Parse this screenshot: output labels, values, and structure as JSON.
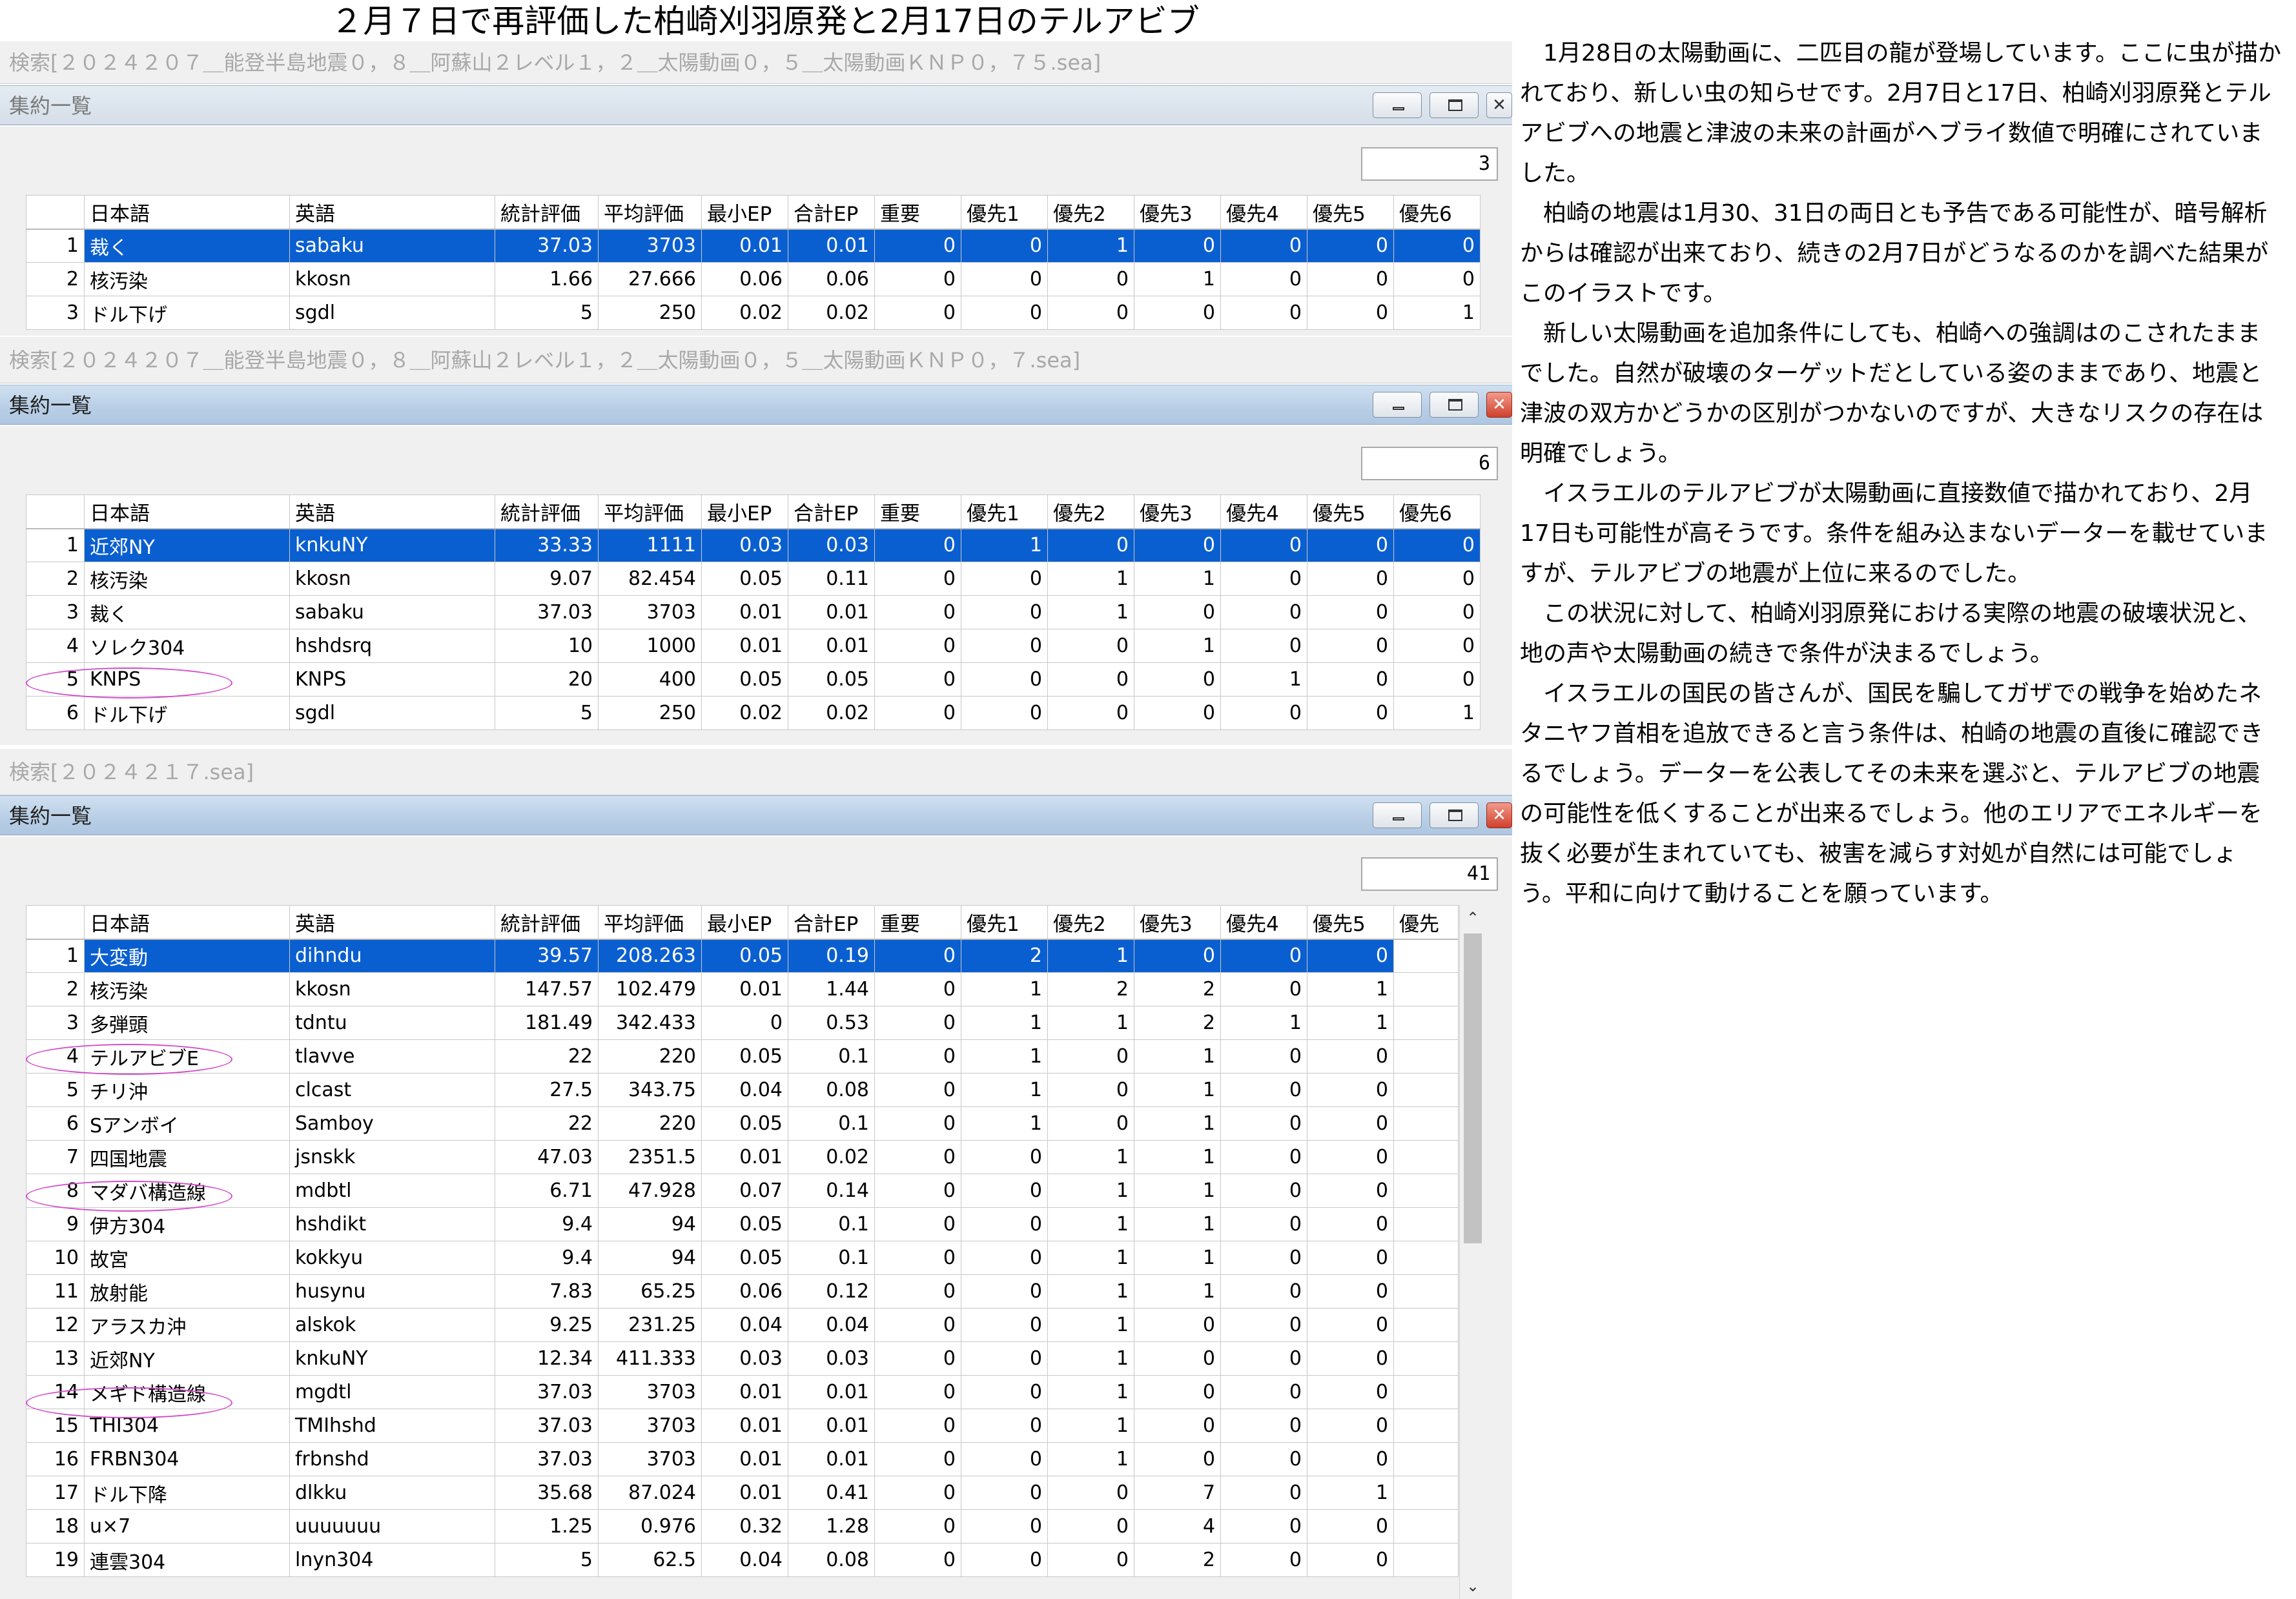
{
  "page": {
    "title": "２月７日で再評価した柏崎刈羽原発と2月17日のテルアビブ"
  },
  "panels": [
    {
      "search_title": "検索[２０２４２０７＿能登半島地震０，８＿阿蘇山２レベル１，２＿太陽動画０，５＿太陽動画ＫＮＰ０，７５.sea]",
      "window_title": "集約一覧",
      "active": false,
      "count": "3",
      "columns": [
        "",
        "日本語",
        "英語",
        "統計評価",
        "平均評価",
        "最小EP",
        "合計EP",
        "重要",
        "優先1",
        "優先2",
        "優先3",
        "優先4",
        "優先5",
        "優先6"
      ],
      "rows": [
        [
          "1",
          "裁く",
          "sabaku",
          "37.03",
          "3703",
          "0.01",
          "0.01",
          "0",
          "0",
          "1",
          "0",
          "0",
          "0",
          "0"
        ],
        [
          "2",
          "核汚染",
          "kkosn",
          "1.66",
          "27.666",
          "0.06",
          "0.06",
          "0",
          "0",
          "0",
          "1",
          "0",
          "0",
          "0"
        ],
        [
          "3",
          "ドル下げ",
          "sgdl",
          "5",
          "250",
          "0.02",
          "0.02",
          "0",
          "0",
          "0",
          "0",
          "0",
          "0",
          "1"
        ]
      ]
    },
    {
      "search_title": "検索[２０２４２０７＿能登半島地震０，８＿阿蘇山２レベル１，２＿太陽動画０，５＿太陽動画ＫＮＰ０，７.sea]",
      "window_title": "集約一覧",
      "active": true,
      "count": "6",
      "columns": [
        "",
        "日本語",
        "英語",
        "統計評価",
        "平均評価",
        "最小EP",
        "合計EP",
        "重要",
        "優先1",
        "優先2",
        "優先3",
        "優先4",
        "優先5",
        "優先6"
      ],
      "rows": [
        [
          "1",
          "近郊NY",
          "knkuNY",
          "33.33",
          "1111",
          "0.03",
          "0.03",
          "0",
          "1",
          "0",
          "0",
          "0",
          "0",
          "0"
        ],
        [
          "2",
          "核汚染",
          "kkosn",
          "9.07",
          "82.454",
          "0.05",
          "0.11",
          "0",
          "0",
          "1",
          "1",
          "0",
          "0",
          "0"
        ],
        [
          "3",
          "裁く",
          "sabaku",
          "37.03",
          "3703",
          "0.01",
          "0.01",
          "0",
          "0",
          "1",
          "0",
          "0",
          "0",
          "0"
        ],
        [
          "4",
          "ソレク304",
          "hshdsrq",
          "10",
          "1000",
          "0.01",
          "0.01",
          "0",
          "0",
          "0",
          "1",
          "0",
          "0",
          "0"
        ],
        [
          "5",
          "KNPS",
          "KNPS",
          "20",
          "400",
          "0.05",
          "0.05",
          "0",
          "0",
          "0",
          "0",
          "1",
          "0",
          "0"
        ],
        [
          "6",
          "ドル下げ",
          "sgdl",
          "5",
          "250",
          "0.02",
          "0.02",
          "0",
          "0",
          "0",
          "0",
          "0",
          "0",
          "1"
        ]
      ]
    },
    {
      "search_title": "検索[２０２４２１７.sea]",
      "window_title": "集約一覧",
      "active": true,
      "count": "41",
      "columns": [
        "",
        "日本語",
        "英語",
        "統計評価",
        "平均評価",
        "最小EP",
        "合計EP",
        "重要",
        "優先1",
        "優先2",
        "優先3",
        "優先4",
        "優先5",
        "優先"
      ],
      "rows": [
        [
          "1",
          "大変動",
          "dihndu",
          "39.57",
          "208.263",
          "0.05",
          "0.19",
          "0",
          "2",
          "1",
          "0",
          "0",
          "0",
          ""
        ],
        [
          "2",
          "核汚染",
          "kkosn",
          "147.57",
          "102.479",
          "0.01",
          "1.44",
          "0",
          "1",
          "2",
          "2",
          "0",
          "1",
          ""
        ],
        [
          "3",
          "多弾頭",
          "tdntu",
          "181.49",
          "342.433",
          "0",
          "0.53",
          "0",
          "1",
          "1",
          "2",
          "1",
          "1",
          ""
        ],
        [
          "4",
          "テルアビブE",
          "tlavve",
          "22",
          "220",
          "0.05",
          "0.1",
          "0",
          "1",
          "0",
          "1",
          "0",
          "0",
          ""
        ],
        [
          "5",
          "チリ沖",
          "clcast",
          "27.5",
          "343.75",
          "0.04",
          "0.08",
          "0",
          "1",
          "0",
          "1",
          "0",
          "0",
          ""
        ],
        [
          "6",
          "Sアンボイ",
          "Samboy",
          "22",
          "220",
          "0.05",
          "0.1",
          "0",
          "1",
          "0",
          "1",
          "0",
          "0",
          ""
        ],
        [
          "7",
          "四国地震",
          "jsnskk",
          "47.03",
          "2351.5",
          "0.01",
          "0.02",
          "0",
          "0",
          "1",
          "1",
          "0",
          "0",
          ""
        ],
        [
          "8",
          "マダバ構造線",
          "mdbtl",
          "6.71",
          "47.928",
          "0.07",
          "0.14",
          "0",
          "0",
          "1",
          "1",
          "0",
          "0",
          ""
        ],
        [
          "9",
          "伊方304",
          "hshdikt",
          "9.4",
          "94",
          "0.05",
          "0.1",
          "0",
          "0",
          "1",
          "1",
          "0",
          "0",
          ""
        ],
        [
          "10",
          "故宮",
          "kokkyu",
          "9.4",
          "94",
          "0.05",
          "0.1",
          "0",
          "0",
          "1",
          "1",
          "0",
          "0",
          ""
        ],
        [
          "11",
          "放射能",
          "husynu",
          "7.83",
          "65.25",
          "0.06",
          "0.12",
          "0",
          "0",
          "1",
          "1",
          "0",
          "0",
          ""
        ],
        [
          "12",
          "アラスカ沖",
          "alskok",
          "9.25",
          "231.25",
          "0.04",
          "0.04",
          "0",
          "0",
          "1",
          "0",
          "0",
          "0",
          ""
        ],
        [
          "13",
          "近郊NY",
          "knkuNY",
          "12.34",
          "411.333",
          "0.03",
          "0.03",
          "0",
          "0",
          "1",
          "0",
          "0",
          "0",
          ""
        ],
        [
          "14",
          "メギド構造線",
          "mgdtl",
          "37.03",
          "3703",
          "0.01",
          "0.01",
          "0",
          "0",
          "1",
          "0",
          "0",
          "0",
          ""
        ],
        [
          "15",
          "THI304",
          "TMIhshd",
          "37.03",
          "3703",
          "0.01",
          "0.01",
          "0",
          "0",
          "1",
          "0",
          "0",
          "0",
          ""
        ],
        [
          "16",
          "FRBN304",
          "frbnshd",
          "37.03",
          "3703",
          "0.01",
          "0.01",
          "0",
          "0",
          "1",
          "0",
          "0",
          "0",
          ""
        ],
        [
          "17",
          "ドル下降",
          "dlkku",
          "35.68",
          "87.024",
          "0.01",
          "0.41",
          "0",
          "0",
          "0",
          "7",
          "0",
          "1",
          ""
        ],
        [
          "18",
          "u×7",
          "uuuuuuu",
          "1.25",
          "0.976",
          "0.32",
          "1.28",
          "0",
          "0",
          "0",
          "4",
          "0",
          "0",
          ""
        ],
        [
          "19",
          "連雲304",
          "lnyn304",
          "5",
          "62.5",
          "0.04",
          "0.08",
          "0",
          "0",
          "0",
          "2",
          "0",
          "0",
          ""
        ]
      ]
    }
  ],
  "article": {
    "paragraphs": [
      "　1月28日の太陽動画に、二匹目の龍が登場しています。ここに虫が描かれており、新しい虫の知らせです。2月7日と17日、柏崎刈羽原発とテルアビブへの地震と津波の未来の計画がヘブライ数値で明確にされていました。",
      "　柏崎の地震は1月30、31日の両日とも予告である可能性が、暗号解析からは確認が出来ており、続きの2月7日がどうなるのかを調べた結果がこのイラストです。",
      "　新しい太陽動画を追加条件にしても、柏崎への強調はのこされたままでした。自然が破壊のターゲットだとしている姿のままであり、地震と津波の双方かどうかの区別がつかないのですが、大きなリスクの存在は明確でしょう。",
      "　イスラエルのテルアビブが太陽動画に直接数値で描かれており、2月17日も可能性が高そうです。条件を組み込まないデーターを載せていますが、テルアビブの地震が上位に来るのでした。",
      "　この状況に対して、柏崎刈羽原発における実際の地震の破壊状況と、地の声や太陽動画の続きで条件が決まるでしょう。",
      "　イスラエルの国民の皆さんが、国民を騙してガザでの戦争を始めたネタニヤフ首相を追放できると言う条件は、柏崎の地震の直後に確認できるでしょう。データーを公表してその未来を選ぶと、テルアビブの地震の可能性を低くすることが出来るでしょう。他のエリアでエネルギーを抜く必要が生まれていても、被害を減らす対処が自然には可能でしょう。平和に向けて動けることを願っています。"
    ]
  },
  "colors": {
    "selection": "#0a5fd0",
    "highlight_ellipse": "#d24ac8"
  }
}
